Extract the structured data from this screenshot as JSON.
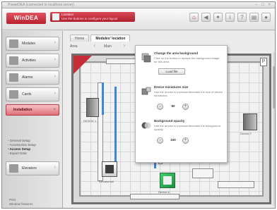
{
  "window": {
    "title": "PowerDEA (connected to localhost server)",
    "controls": "– □ ×"
  },
  "header": {
    "logo": "WinDEA",
    "panel_line1": "Location",
    "panel_line2": "Use the buttons to configure your layout",
    "icons": [
      {
        "name": "home-icon",
        "glyph": "⌂"
      },
      {
        "name": "back-icon",
        "glyph": "◀"
      },
      {
        "name": "settings-icon",
        "glyph": "✦"
      },
      {
        "name": "info-icon",
        "glyph": "i"
      },
      {
        "name": "help-icon",
        "glyph": "?"
      },
      {
        "name": "document-icon",
        "glyph": "▤"
      },
      {
        "name": "user-icon",
        "glyph": "●"
      }
    ]
  },
  "sidebar": {
    "items": [
      {
        "label": "Modules"
      },
      {
        "label": "Activities"
      },
      {
        "label": "Alarms"
      },
      {
        "label": "Cards"
      },
      {
        "label": "Installation"
      },
      {
        "label": "Elevators"
      }
    ],
    "subitems": [
      {
        "label": "General Setup"
      },
      {
        "label": "Accessories Setup"
      },
      {
        "label": "Access Setup"
      },
      {
        "label": "Export Data"
      }
    ],
    "footer_line1": "Print",
    "footer_line2": "Window features"
  },
  "main": {
    "tabs": [
      {
        "label": "Home"
      },
      {
        "label": "Modules' location"
      }
    ],
    "toolbar_label": "Area",
    "area_name": "Main",
    "devices": [
      {
        "label": "DEVICE 1"
      },
      {
        "label": "Device 2"
      },
      {
        "label": "Elevatorhall"
      },
      {
        "label": "Device A"
      }
    ]
  },
  "popup": {
    "section1": {
      "title": "Change the area background",
      "desc": "Click on the button to replace the background image for this area",
      "button": "Load file"
    },
    "section2": {
      "title": "Device miniatures size",
      "desc": "Use the arrows to increase/decrease the size of device miniatures",
      "value": "80"
    },
    "section3": {
      "title": "Background opacity",
      "desc": "Use the arrows to increase/decrease the background opacity",
      "value": "100"
    }
  },
  "colors": {
    "brand": "#c3222e",
    "accent_green": "#2fb35a",
    "accent_blue": "#3f86d8"
  }
}
